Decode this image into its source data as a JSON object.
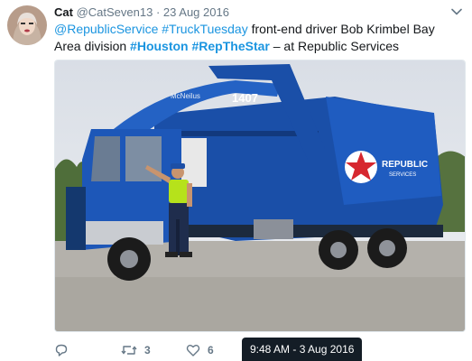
{
  "tweet": {
    "display_name": "Cat",
    "handle": "@CatSeven13",
    "separator": "·",
    "date": "23 Aug 2016",
    "text": {
      "mention": "@RepublicService",
      "hashtag_truck": "#TruckTuesday",
      "body_1": " front-end driver Bob Krimbel Bay Area division ",
      "hashtag_houston": "#Houston",
      "space": " ",
      "hashtag_star": "#RepTheStar",
      "location": "  – at Republic Services"
    }
  },
  "photo": {
    "truck_brand": "McNeilus",
    "truck_number": "1407",
    "logo_line_1": "REPUBLIC",
    "logo_line_2": "SERVICES"
  },
  "actions": {
    "reply_icon": "reply-icon",
    "retweet_icon": "retweet-icon",
    "retweet_count": "3",
    "like_icon": "heart-icon",
    "like_count": "6"
  },
  "tooltip": {
    "text": "9:48 AM - 3 Aug 2016"
  },
  "colors": {
    "link": "#1b95e0",
    "muted": "#657786",
    "truck_blue": "#1a4fa8",
    "tooltip_bg": "#141d26"
  }
}
